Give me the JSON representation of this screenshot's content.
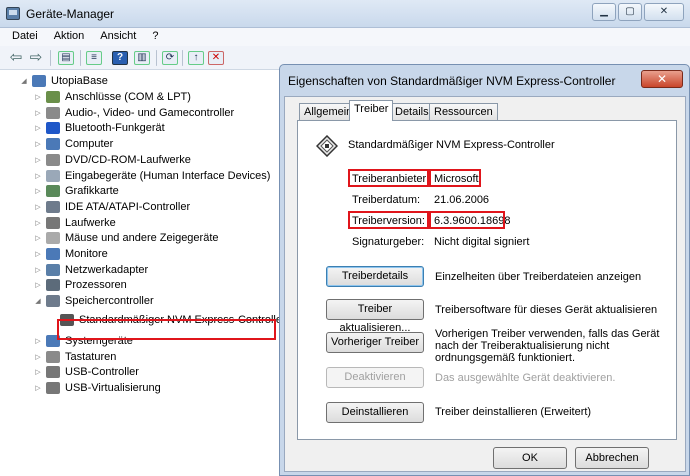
{
  "window": {
    "title": "Geräte-Manager",
    "controls": [
      "▁",
      "▢",
      "✕"
    ]
  },
  "menu": [
    "Datei",
    "Aktion",
    "Ansicht",
    "?"
  ],
  "tree": {
    "root": "UtopiaBase",
    "items": [
      {
        "label": "Anschlüsse (COM & LPT)",
        "icon": "port-icon",
        "color": "#6a8f4a"
      },
      {
        "label": "Audio-, Video- und Gamecontroller",
        "icon": "speaker-icon",
        "color": "#8a8a8a"
      },
      {
        "label": "Bluetooth-Funkgerät",
        "icon": "bluetooth-icon",
        "color": "#1f57c8"
      },
      {
        "label": "Computer",
        "icon": "computer-icon",
        "color": "#4b79b7"
      },
      {
        "label": "DVD/CD-ROM-Laufwerke",
        "icon": "dvd-drive-icon",
        "color": "#8a8a8a"
      },
      {
        "label": "Eingabegeräte (Human Interface Devices)",
        "icon": "hid-icon",
        "color": "#9aa8b8"
      },
      {
        "label": "Grafikkarte",
        "icon": "display-adapter-icon",
        "color": "#5a8a5a"
      },
      {
        "label": "IDE ATA/ATAPI-Controller",
        "icon": "ide-controller-icon",
        "color": "#6e7b8c"
      },
      {
        "label": "Laufwerke",
        "icon": "disk-drive-icon",
        "color": "#777777"
      },
      {
        "label": "Mäuse und andere Zeigegeräte",
        "icon": "mouse-icon",
        "color": "#aaaaaa"
      },
      {
        "label": "Monitore",
        "icon": "monitor-icon",
        "color": "#4b79b7"
      },
      {
        "label": "Netzwerkadapter",
        "icon": "network-adapter-icon",
        "color": "#5a7fa8"
      },
      {
        "label": "Prozessoren",
        "icon": "processor-icon",
        "color": "#5c6b7a"
      },
      {
        "label": "Speichercontroller",
        "icon": "storage-controller-icon",
        "color": "#6e7b8c",
        "expanded": true
      },
      {
        "label": "Standardmäßiger NVM Express-Controller",
        "icon": "nvme-controller-icon",
        "color": "#555555",
        "child": true,
        "selected": true
      },
      {
        "label": "Systemgeräte",
        "icon": "system-device-icon",
        "color": "#4b79b7"
      },
      {
        "label": "Tastaturen",
        "icon": "keyboard-icon",
        "color": "#8a8a8a"
      },
      {
        "label": "USB-Controller",
        "icon": "usb-icon",
        "color": "#777777"
      },
      {
        "label": "USB-Virtualisierung",
        "icon": "usb-icon",
        "color": "#777777"
      }
    ]
  },
  "dialog": {
    "title": "Eigenschaften von Standardmäßiger NVM Express-Controller",
    "close": "✕",
    "tabs": [
      "Allgemein",
      "Treiber",
      "Details",
      "Ressourcen"
    ],
    "active_tab": "Treiber",
    "device_name": "Standardmäßiger NVM Express-Controller",
    "info": [
      {
        "label": "Treiberanbieter:",
        "value": "Microsoft"
      },
      {
        "label": "Treiberdatum:",
        "value": "21.06.2006"
      },
      {
        "label": "Treiberversion:",
        "value": "6.3.9600.18698"
      },
      {
        "label": "Signaturgeber:",
        "value": "Nicht digital signiert"
      }
    ],
    "actions": [
      {
        "button": "Treiberdetails",
        "desc": "Einzelheiten über Treiberdateien anzeigen"
      },
      {
        "button": "Treiber aktualisieren...",
        "desc": "Treibersoftware für dieses Gerät aktualisieren"
      },
      {
        "button": "Vorheriger Treiber",
        "desc": "Vorherigen Treiber verwenden, falls das Gerät nach der Treiberaktualisierung nicht ordnungsgemäß funktioniert."
      },
      {
        "button": "Deaktivieren",
        "desc": "Das ausgewählte Gerät deaktivieren.",
        "disabled": true
      },
      {
        "button": "Deinstallieren",
        "desc": "Treiber deinstallieren (Erweitert)"
      }
    ],
    "ok": "OK",
    "cancel": "Abbrechen"
  },
  "colors": {
    "highlight_box": "#e0151b",
    "title_bar": "#c9d9ec",
    "dialog_frame": "#c8d7ea"
  }
}
